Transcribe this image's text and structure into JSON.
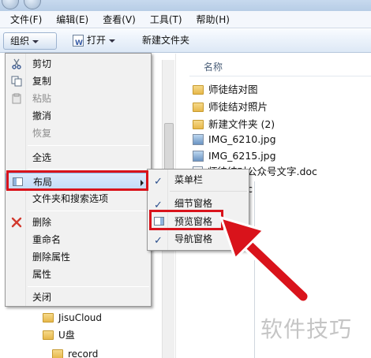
{
  "menubar": {
    "file": "文件(F)",
    "edit": "编辑(E)",
    "view": "查看(V)",
    "tools": "工具(T)",
    "help": "帮助(H)"
  },
  "toolbar": {
    "organize": "组织",
    "open": "打开",
    "new_folder": "新建文件夹"
  },
  "context_menu": {
    "items": {
      "cut": "剪切",
      "copy": "复制",
      "paste": "粘贴",
      "undo": "撤消",
      "redo": "恢复",
      "select_all": "全选",
      "layout": "布局",
      "folder_options": "文件夹和搜索选项",
      "delete": "删除",
      "rename": "重命名",
      "remove_properties": "删除属性",
      "properties": "属性",
      "close": "关闭"
    }
  },
  "layout_submenu": {
    "menu_bar": "菜单栏",
    "details_pane": "细节窗格",
    "preview_pane": "预览窗格",
    "navigation_pane": "导航窗格"
  },
  "file_pane": {
    "column_name": "名称",
    "files": [
      "师徒结对图",
      "师徒结对照片",
      "新建文件夹 (2)",
      "IMG_6210.jpg",
      "IMG_6215.jpg",
      "师徒结对公众号文字.doc",
      "oc"
    ]
  },
  "nav_pane": {
    "items": [
      "JisuCloud",
      "U盘",
      "record"
    ]
  },
  "watermark": "软件技巧",
  "colors": {
    "highlight_red": "#d9131b",
    "hover_blue": "#c4dcf8"
  }
}
